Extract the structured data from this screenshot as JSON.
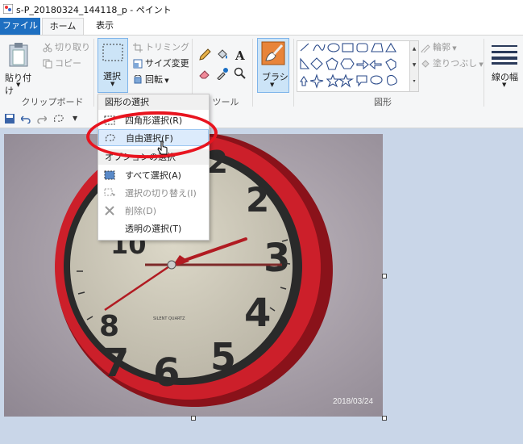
{
  "window": {
    "title": "s-P_20180324_144118_p - ペイント"
  },
  "tabs": {
    "file": "ファイル",
    "home": "ホーム",
    "view": "表示"
  },
  "ribbon": {
    "clipboard": {
      "paste": "貼り付け",
      "cut": "切り取り",
      "copy": "コピー",
      "group_label": "クリップボード"
    },
    "image": {
      "select": "選択",
      "crop": "トリミング",
      "resize": "サイズ変更",
      "rotate": "回転"
    },
    "tools": {
      "group_label": "ツール"
    },
    "brush": {
      "label": "ブラシ"
    },
    "shapes": {
      "outline": "輪郭",
      "fill": "塗りつぶし",
      "group_label": "図形"
    },
    "size": {
      "label": "線の幅"
    }
  },
  "dropdown": {
    "header_shapes": "図形の選択",
    "rect_select": "四角形選択(R)",
    "free_select": "自由選択(F)",
    "header_options": "オプションの選択",
    "select_all": "すべて選択(A)",
    "invert_select": "選択の切り替え(I)",
    "delete": "削除(D)",
    "transparent_select": "透明の選択(T)"
  },
  "photo": {
    "date_stamp": "2018/03/24"
  },
  "colors": {
    "file_tab": "#1e6fc1",
    "highlight_ellipse": "#e8141f",
    "ribbon_bg": "#f5f6f7",
    "canvas_bg": "#c9d6e8",
    "clock_frame": "#cc1f2a"
  },
  "icons": [
    "paint-app-icon",
    "paste-icon",
    "cut-icon",
    "copy-icon",
    "select-icon",
    "crop-icon",
    "resize-icon",
    "rotate-icon",
    "pencil-icon",
    "fill-icon",
    "text-icon",
    "eraser-icon",
    "color-picker-icon",
    "magnifier-icon",
    "brush-icon",
    "shapes-gallery",
    "outline-icon",
    "fill-shape-icon",
    "size-icon",
    "save-icon",
    "undo-icon",
    "redo-icon",
    "free-select-icon",
    "qat-dropdown-icon"
  ]
}
